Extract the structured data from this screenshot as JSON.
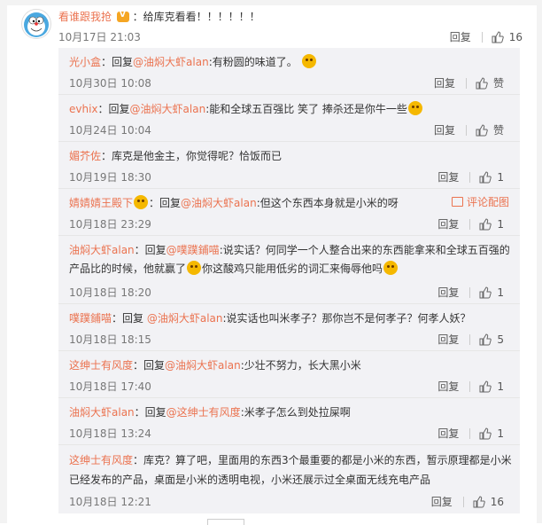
{
  "root": {
    "user": "看谁跟我抢",
    "text": "：给库克看看！！！！！！",
    "time": "10月17日 21:03",
    "reply_label": "回复",
    "likes": "16"
  },
  "replies": [
    {
      "user": "光小盒",
      "prefix": "：回复",
      "mention": "@油焖大虾alan",
      "body": ":有粉圆的味道了。",
      "time": "10月30日 10:08",
      "reply_label": "回复",
      "likes": "赞"
    },
    {
      "user": "evhix",
      "prefix": "：回复",
      "mention": "@油焖大虾alan",
      "body": ":能和全球五百强比 笑了 捧杀还是你牛一些",
      "time": "10月24日 10:04",
      "reply_label": "回复",
      "likes": "赞"
    },
    {
      "user": "媚芥佐",
      "prefix": "：",
      "mention": "",
      "body": "库克是他金主，你觉得呢？恰饭而已",
      "time": "10月19日 18:30",
      "reply_label": "回复",
      "likes": "1"
    },
    {
      "user": "婧婧婧王殿下",
      "prefix": "：回复",
      "mention": "@油焖大虾alan",
      "body": ":但这个东西本身就是小米的呀",
      "time": "10月18日 23:29",
      "reply_label": "回复",
      "likes": "1",
      "report": "评论配图"
    },
    {
      "user": "油焖大虾alan",
      "prefix": "：回复",
      "mention": "@噗蹼鋪喵",
      "body": ":说实话？何同学一个人整合出来的东西能拿来和全球五百强的产品比的时候，他就赢了",
      "body2": "你这酸鸡只能用低劣的词汇来侮辱他吗",
      "time": "10月18日 18:20",
      "reply_label": "回复",
      "likes": "1"
    },
    {
      "user": "噗蹼鋪喵",
      "prefix": "：回复 ",
      "mention": "@油焖大虾alan",
      "body": ":说实话也叫米孝子？那你岂不是何孝子？何孝人妖？",
      "time": "10月18日 18:15",
      "reply_label": "回复",
      "likes": "5"
    },
    {
      "user": "这绅士有风度",
      "prefix": "：回复",
      "mention": "@油焖大虾alan",
      "body": ":少壮不努力，长大黑小米",
      "time": "10月18日 17:40",
      "reply_label": "回复",
      "likes": "1"
    },
    {
      "user": "油焖大虾alan",
      "prefix": "：回复",
      "mention": "@这绅士有风度",
      "body": ":米孝子怎么到处拉屎啊",
      "time": "10月18日 13:24",
      "reply_label": "回复",
      "likes": "1"
    },
    {
      "user": "这绅士有风度",
      "prefix": "：",
      "mention": "",
      "body": "库克？算了吧，里面用的东西3个最重要的都是小米的东西，暂示原理都是小米已经发布的产品，桌面是小米的透明电视，小米还展示过全桌面无线充电产品",
      "time": "10月18日 12:21",
      "reply_label": "回复",
      "likes": "16"
    }
  ]
}
